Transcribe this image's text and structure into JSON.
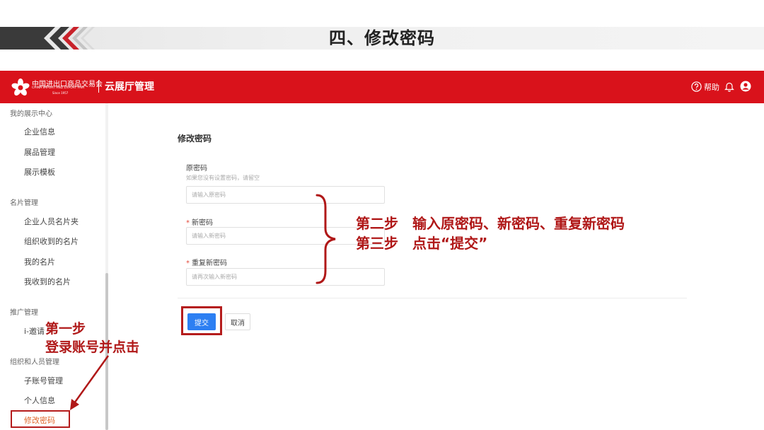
{
  "slide": {
    "title": "四、修改密码"
  },
  "header": {
    "logo_cn": "中国进出口商品交易会",
    "logo_en": "CHINA IMPORT AND EXPORT FAIR",
    "logo_since": "Since 1957",
    "app_title": "云展厅管理",
    "help_label": "帮助",
    "brand_color": "#d9121b"
  },
  "sidebar": {
    "groups": [
      {
        "label": "我的展示中心",
        "items": [
          "企业信息",
          "展品管理",
          "展示模板"
        ]
      },
      {
        "label": "名片管理",
        "items": [
          "企业人员名片夹",
          "组织收到的名片",
          "我的名片",
          "我收到的名片"
        ]
      },
      {
        "label": "推广管理",
        "items": [
          "i-邀请"
        ]
      },
      {
        "label": "组织和人员管理",
        "items": [
          "子账号管理",
          "个人信息",
          "修改密码"
        ]
      }
    ],
    "active_item": "修改密码"
  },
  "form": {
    "title": "修改密码",
    "old_password": {
      "label": "原密码",
      "hint": "如果您没有设置密码，请留空",
      "placeholder": "请输入原密码"
    },
    "new_password": {
      "label": "新密码",
      "required_mark": "*",
      "placeholder": "请输入新密码"
    },
    "confirm_password": {
      "label": "重复新密码",
      "required_mark": "*",
      "placeholder": "请再次输入新密码"
    },
    "submit_label": "提交",
    "cancel_label": "取消",
    "accent_color": "#2d7ff2"
  },
  "annotations": {
    "step2": "第二步　输入原密码、新密码、重复新密码",
    "step3": "第三步　点击“提交”",
    "step1_title": "第一步",
    "step1_desc": "登录账号并点击",
    "color": "#b01818"
  }
}
